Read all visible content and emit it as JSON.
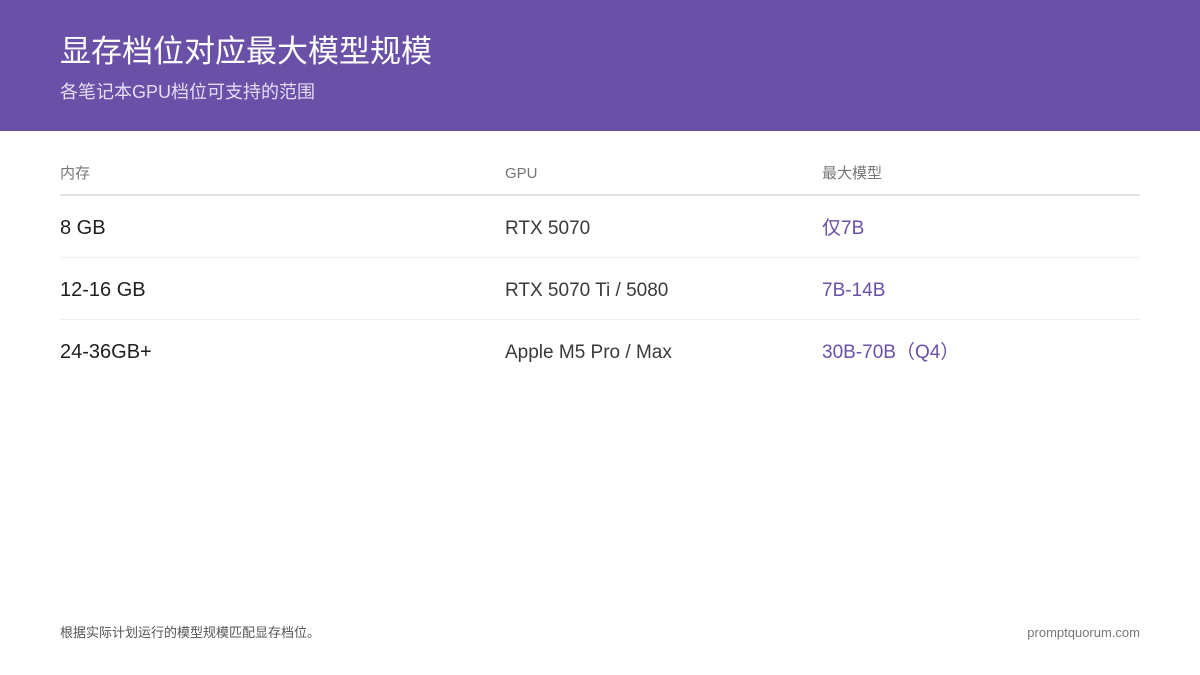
{
  "header": {
    "title": "显存档位对应最大模型规模",
    "subtitle": "各笔记本GPU档位可支持的范围"
  },
  "table": {
    "columns": [
      "内存",
      "GPU",
      "最大模型"
    ],
    "rows": [
      {
        "memory": "8 GB",
        "gpu": "RTX 5070",
        "max_model": "仅7B"
      },
      {
        "memory": "12-16 GB",
        "gpu": "RTX 5070 Ti / 5080",
        "max_model": "7B-14B"
      },
      {
        "memory": "24-36GB+",
        "gpu": "Apple M5 Pro / Max",
        "max_model": "30B-70B（Q4）"
      }
    ]
  },
  "footer": {
    "note": "根据实际计划运行的模型规模匹配显存档位。",
    "brand": "promptquorum.com"
  },
  "colors": {
    "header_bg": "#6a50a7",
    "accent": "#6a50a7"
  }
}
